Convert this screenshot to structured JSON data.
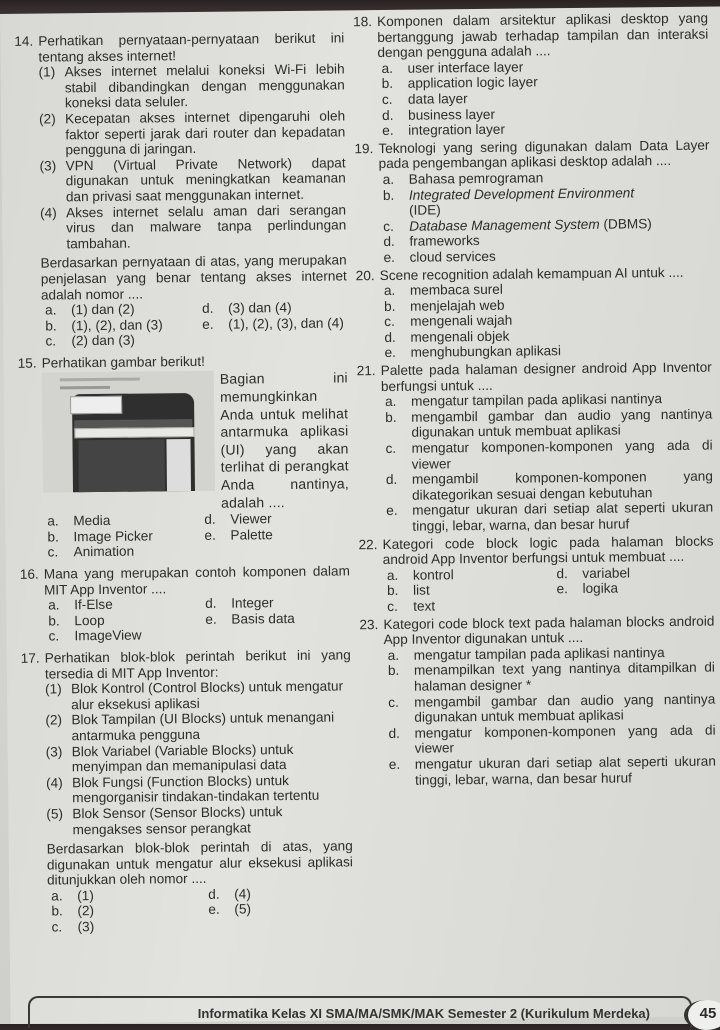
{
  "left_column": {
    "q14": {
      "number": "14.",
      "stem": "Perhatikan pernyataan-pernyataan berikut ini tentang akses internet!",
      "statements": [
        {
          "num": "(1)",
          "text": "Akses internet melalui koneksi Wi-Fi lebih stabil dibandingkan dengan menggunakan koneksi data seluler."
        },
        {
          "num": "(2)",
          "text": "Kecepatan akses internet dipengaruhi oleh faktor seperti jarak dari router dan kepadatan pengguna di jaringan."
        },
        {
          "num": "(3)",
          "text": "VPN (Virtual Private Network) dapat digunakan untuk meningkatkan keamanan dan privasi saat menggunakan internet."
        },
        {
          "num": "(4)",
          "text": "Akses internet selalu aman dari serangan virus dan malware tanpa perlindungan tambahan."
        }
      ],
      "question": "Berdasarkan pernyataan di atas, yang merupakan penjelasan yang benar tentang akses internet adalah nomor ....",
      "options": [
        {
          "letter": "a.",
          "text": "(1) dan (2)"
        },
        {
          "letter": "d.",
          "text": "(3) dan (4)"
        },
        {
          "letter": "b.",
          "text": "(1), (2), dan (3)"
        },
        {
          "letter": "e.",
          "text": "(1), (2), (3), dan (4)"
        },
        {
          "letter": "c.",
          "text": "(2) dan (3)"
        }
      ]
    },
    "q15": {
      "number": "15.",
      "stem": "Perhatikan gambar berikut!",
      "side_text": "Bagian ini memungkinkan Anda untuk melihat antarmuka aplikasi (UI) yang akan terlihat di perangkat Anda nantinya, adalah ....",
      "options": [
        {
          "letter": "a.",
          "text": "Media"
        },
        {
          "letter": "d.",
          "text": "Viewer"
        },
        {
          "letter": "b.",
          "text": "Image Picker"
        },
        {
          "letter": "e.",
          "text": "Palette"
        },
        {
          "letter": "c.",
          "text": "Animation"
        }
      ]
    },
    "q16": {
      "number": "16.",
      "stem": "Mana yang merupakan contoh komponen dalam MIT App Inventor ....",
      "options": [
        {
          "letter": "a.",
          "text": "If-Else"
        },
        {
          "letter": "d.",
          "text": "Integer"
        },
        {
          "letter": "b.",
          "text": "Loop"
        },
        {
          "letter": "e.",
          "text": "Basis data"
        },
        {
          "letter": "c.",
          "text": "ImageView"
        }
      ]
    },
    "q17": {
      "number": "17.",
      "stem": "Perhatikan blok-blok perintah berikut ini yang tersedia di MIT App Inventor:",
      "statements": [
        {
          "num": "(1)",
          "text": "Blok Kontrol (Control Blocks) untuk mengatur alur eksekusi aplikasi"
        },
        {
          "num": "(2)",
          "text": "Blok Tampilan (UI Blocks) untuk menangani antarmuka pengguna"
        },
        {
          "num": "(3)",
          "text": "Blok Variabel (Variable Blocks) untuk menyimpan dan memanipulasi data"
        },
        {
          "num": "(4)",
          "text": "Blok Fungsi (Function Blocks) untuk mengorganisir tindakan-tindakan tertentu"
        },
        {
          "num": "(5)",
          "text": "Blok Sensor (Sensor Blocks) untuk mengakses sensor perangkat"
        }
      ],
      "question": "Berdasarkan blok-blok perintah di atas, yang digunakan untuk mengatur alur eksekusi aplikasi ditunjukkan oleh nomor ....",
      "options": [
        {
          "letter": "a.",
          "text": "(1)"
        },
        {
          "letter": "d.",
          "text": "(4)"
        },
        {
          "letter": "b.",
          "text": "(2)"
        },
        {
          "letter": "e.",
          "text": "(5)"
        },
        {
          "letter": "c.",
          "text": "(3)"
        }
      ]
    }
  },
  "right_column": {
    "q18": {
      "number": "18.",
      "stem": "Komponen dalam arsitektur aplikasi desktop yang bertanggung jawab terhadap tampilan dan interaksi dengan pengguna adalah ....",
      "options": [
        {
          "letter": "a.",
          "text": "user interface layer"
        },
        {
          "letter": "b.",
          "text": "application logic layer"
        },
        {
          "letter": "c.",
          "text": "data layer"
        },
        {
          "letter": "d.",
          "text": "business layer"
        },
        {
          "letter": "e.",
          "text": "integration layer"
        }
      ]
    },
    "q19": {
      "number": "19.",
      "stem": "Teknologi yang sering digunakan dalam Data Layer pada pengembangan aplikasi desktop adalah ....",
      "options": [
        {
          "letter": "a.",
          "text": "Bahasa pemrograman"
        },
        {
          "letter": "b.",
          "text": "Integrated Development Environment",
          "suffix": "(IDE)"
        },
        {
          "letter": "c.",
          "text": "Database Management System",
          "suffix": "(DBMS)"
        },
        {
          "letter": "d.",
          "text": "frameworks"
        },
        {
          "letter": "e.",
          "text": "cloud services"
        }
      ]
    },
    "q20": {
      "number": "20.",
      "stem": "Scene recognition adalah kemampuan AI untuk ....",
      "options": [
        {
          "letter": "a.",
          "text": "membaca surel"
        },
        {
          "letter": "b.",
          "text": "menjelajah web"
        },
        {
          "letter": "c.",
          "text": "mengenali wajah"
        },
        {
          "letter": "d.",
          "text": "mengenali objek"
        },
        {
          "letter": "e.",
          "text": "menghubungkan aplikasi"
        }
      ]
    },
    "q21": {
      "number": "21.",
      "stem": "Palette pada halaman designer android App Inventor berfungsi untuk ....",
      "options": [
        {
          "letter": "a.",
          "text": "mengatur tampilan pada aplikasi nantinya"
        },
        {
          "letter": "b.",
          "text": "mengambil gambar dan audio yang nantinya digunakan untuk membuat aplikasi"
        },
        {
          "letter": "c.",
          "text": "mengatur komponen-komponen yang ada di viewer"
        },
        {
          "letter": "d.",
          "text": "mengambil komponen-komponen yang dikategorikan sesuai dengan kebutuhan"
        },
        {
          "letter": "e.",
          "text": "mengatur ukuran dari setiap alat seperti ukuran tinggi, lebar, warna, dan besar huruf"
        }
      ]
    },
    "q22": {
      "number": "22.",
      "stem": "Kategori code block logic pada halaman blocks android App Inventor berfungsi untuk membuat ....",
      "options": [
        {
          "letter": "a.",
          "text": "kontrol"
        },
        {
          "letter": "d.",
          "text": "variabel"
        },
        {
          "letter": "b.",
          "text": "list"
        },
        {
          "letter": "e.",
          "text": "logika"
        },
        {
          "letter": "c.",
          "text": "text"
        }
      ]
    },
    "q23": {
      "number": "23.",
      "stem": "Kategori code block text pada halaman blocks android App Inventor digunakan untuk ....",
      "options": [
        {
          "letter": "a.",
          "text": "mengatur tampilan pada aplikasi nantinya"
        },
        {
          "letter": "b.",
          "text": "menampilkan text yang nantinya ditampilkan di halaman designer *"
        },
        {
          "letter": "c.",
          "text": "mengambil gambar dan audio yang nantinya digunakan untuk membuat aplikasi"
        },
        {
          "letter": "d.",
          "text": "mengatur komponen-komponen yang ada di viewer"
        },
        {
          "letter": "e.",
          "text": "mengatur ukuran dari setiap alat seperti ukuran tinggi, lebar, warna, dan besar huruf"
        }
      ]
    }
  },
  "footer": {
    "book_title": "Informatika Kelas XI SMA/MA/SMK/MAK Semester 2 (Kurikulum Merdeka)",
    "page_number": "45"
  }
}
